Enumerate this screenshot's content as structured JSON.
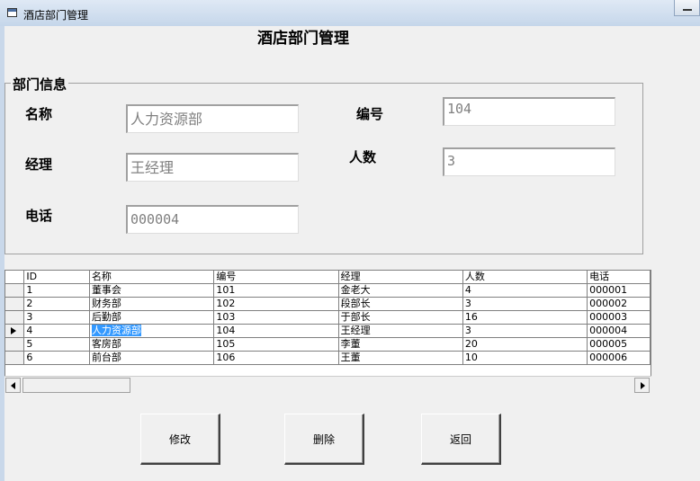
{
  "window": {
    "title": "酒店部门管理"
  },
  "heading": "酒店部门管理",
  "group": {
    "legend": "部门信息",
    "name_label": "名称",
    "name_value": "人力资源部",
    "manager_label": "经理",
    "manager_value": "王经理",
    "phone_label": "电话",
    "phone_value": "000004",
    "id_label": "编号",
    "id_value": "104",
    "count_label": "人数",
    "count_value": "3"
  },
  "grid": {
    "columns": [
      "ID",
      "名称",
      "编号",
      "经理",
      "人数",
      "电话"
    ],
    "rows": [
      [
        "1",
        "董事会",
        "101",
        "金老大",
        "4",
        "000001"
      ],
      [
        "2",
        "财务部",
        "102",
        "段部长",
        "3",
        "000002"
      ],
      [
        "3",
        "后勤部",
        "103",
        "于部长",
        "16",
        "000003"
      ],
      [
        "4",
        "人力资源部",
        "104",
        "王经理",
        "3",
        "000004"
      ],
      [
        "5",
        "客房部",
        "105",
        "李董",
        "20",
        "000005"
      ],
      [
        "6",
        "前台部",
        "106",
        "王董",
        "10",
        "000006"
      ]
    ],
    "current_row": 3
  },
  "buttons": {
    "modify": "修改",
    "delete": "删除",
    "back": "返回"
  }
}
